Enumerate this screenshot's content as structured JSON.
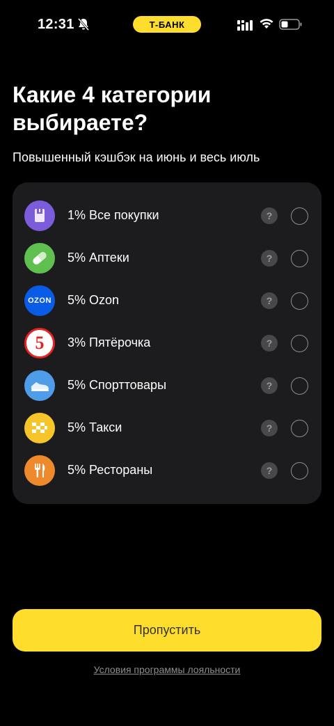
{
  "status_bar": {
    "time": "12:31",
    "bank": "Т-БАНК",
    "icons": [
      "bell-mute-icon",
      "signal-icon",
      "wifi-icon",
      "battery-icon"
    ]
  },
  "header": {
    "title_line1": "Какие 4 категории",
    "title_line2": "выбираете?",
    "subtitle": "Повышенный кэшбэк на июнь и весь июль"
  },
  "categories": [
    {
      "label": "1% Все покупки",
      "icon": "shopping-bag-icon",
      "color": "#7b5cdb",
      "help": "?"
    },
    {
      "label": "5% Аптеки",
      "icon": "pill-icon",
      "color": "#5fbf4f",
      "help": "?"
    },
    {
      "label": "5% Ozon",
      "icon": "ozon-logo-icon",
      "color": "#0a5be6",
      "logo_text": "OZON",
      "help": "?"
    },
    {
      "label": "3% Пятёрочка",
      "icon": "pyaterochka-logo-icon",
      "color": "#e52421",
      "logo_text": "5",
      "help": "?"
    },
    {
      "label": "5% Спорттовары",
      "icon": "sneaker-icon",
      "color": "#4f9ce8",
      "help": "?"
    },
    {
      "label": "5% Такси",
      "icon": "taxi-checker-icon",
      "color": "#f5c52a",
      "help": "?"
    },
    {
      "label": "5% Рестораны",
      "icon": "fork-knife-icon",
      "color": "#ef8a2c",
      "help": "?"
    }
  ],
  "actions": {
    "skip_label": "Пропустить",
    "terms_label": "Условия программы лояльности"
  },
  "colors": {
    "accent": "#ffdd2d",
    "background": "#000000",
    "card": "#1c1c1e"
  }
}
